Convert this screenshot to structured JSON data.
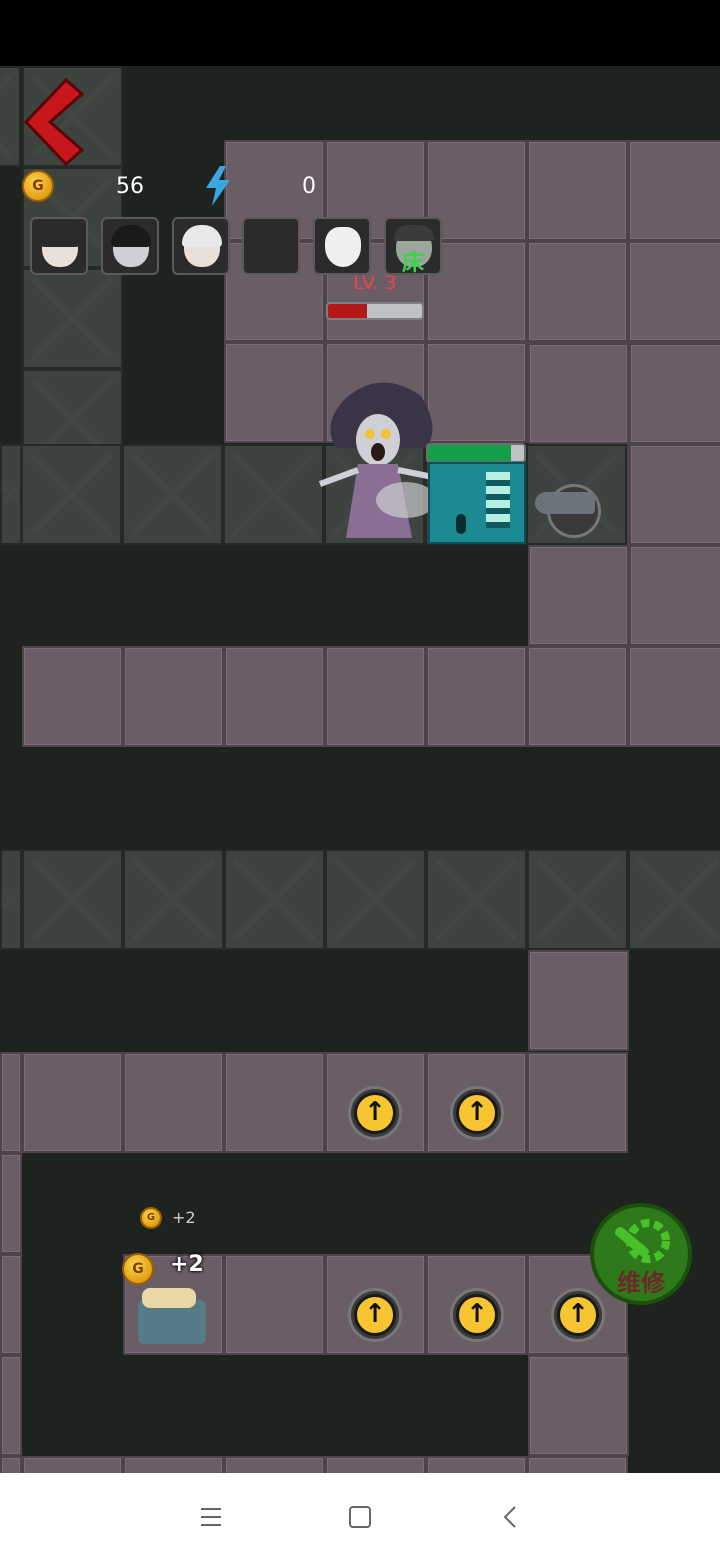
{
  "hud": {
    "coins": "56",
    "energy": "0",
    "coin_glyph": "G"
  },
  "portraits": [
    {
      "name": "boy-portrait"
    },
    {
      "name": "girl-portrait"
    },
    {
      "name": "grandma-portrait"
    },
    {
      "name": "empty-slot"
    },
    {
      "name": "fox-mask-portrait"
    },
    {
      "name": "sleeping-girl-portrait",
      "tag": "床"
    }
  ],
  "ghost": {
    "level_label": "LV. 3",
    "hp_fraction": 0.42
  },
  "door": {
    "hp_fraction": 0.86
  },
  "income": {
    "floating_label": "+2",
    "bed_label": "+2",
    "coin_glyph": "G"
  },
  "repair_button": {
    "label": "维修"
  },
  "colors": {
    "accent_red": "#c8161d",
    "level_red": "#e8444a",
    "door_teal": "#1c8a93",
    "repair_green": "#2e7a1a",
    "coin_gold": "#ffd24a"
  },
  "icons": {
    "back": "chevron-left-icon",
    "coin": "coin-icon",
    "energy": "lightning-icon",
    "repair": "gear-wrench-icon",
    "upgrade": "arrow-up-icon"
  }
}
